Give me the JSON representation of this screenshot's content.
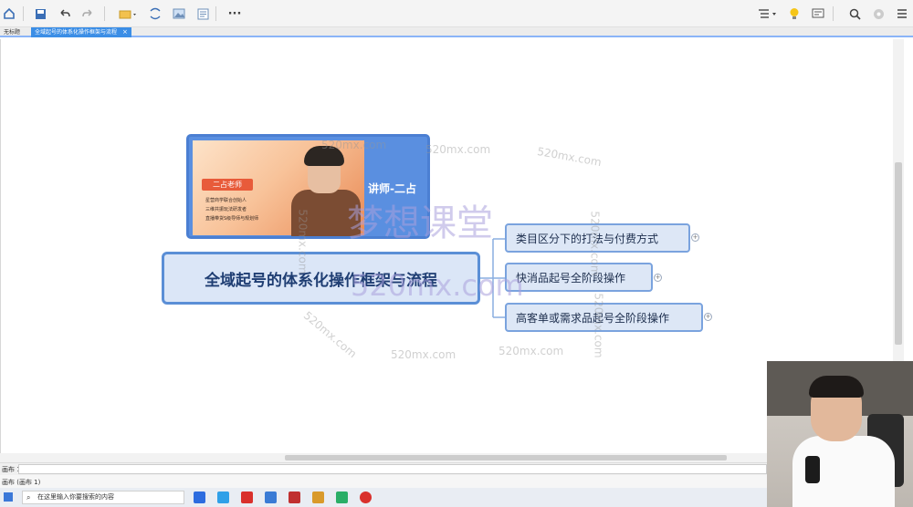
{
  "toolbar": {
    "more_label": "···",
    "icons_left": [
      "home-icon",
      "save-icon",
      "undo-icon",
      "redo-icon",
      "insert-topic-icon",
      "relationship-icon",
      "image-icon",
      "notes-icon",
      "more-icon"
    ],
    "icons_right": [
      "outline-icon",
      "lightbulb-icon",
      "presentation-icon",
      "search-icon",
      "share-icon",
      "menu-icon"
    ]
  },
  "tabs": [
    {
      "label": "无标题",
      "active": false
    },
    {
      "label": "全域起号的体系化操作框架与流程",
      "active": true,
      "close": "×"
    }
  ],
  "map": {
    "teacher_card": {
      "tag": "二占老师",
      "desc_lines": [
        "星营商学联合创始人",
        "三维共振玩法研发者",
        "直播带货S级导师与规划师"
      ],
      "teacher": "讲师-二占"
    },
    "central_topic": "全域起号的体系化操作框架与流程",
    "subtopics": [
      {
        "label": "类目区分下的打法与付费方式",
        "expand": "+"
      },
      {
        "label": "快消品起号全阶段操作",
        "expand": "+"
      },
      {
        "label": "高客单或需求品起号全阶段操作",
        "expand": "+"
      }
    ]
  },
  "watermarks": {
    "small": [
      "520mx.com",
      "520mx.com",
      "520mx.com",
      "520mx.com",
      "520mx.com",
      "520mx.com",
      "520mx.com",
      "520mx.com",
      "520mx.com"
    ],
    "big_title": "梦想课堂",
    "big_url": "520mx.com"
  },
  "statusbar": {
    "sheet": "画布 1",
    "sheet2": "画布 (画布 1)"
  },
  "taskbar": {
    "search_placeholder": "在这里输入你要搜索的内容",
    "app_colors": [
      "#2d6cdf",
      "#2fa0e8",
      "#d9302c",
      "#3a7bd5",
      "#c03030",
      "#d99a2b",
      "#2aae67",
      "#d9302c"
    ]
  }
}
